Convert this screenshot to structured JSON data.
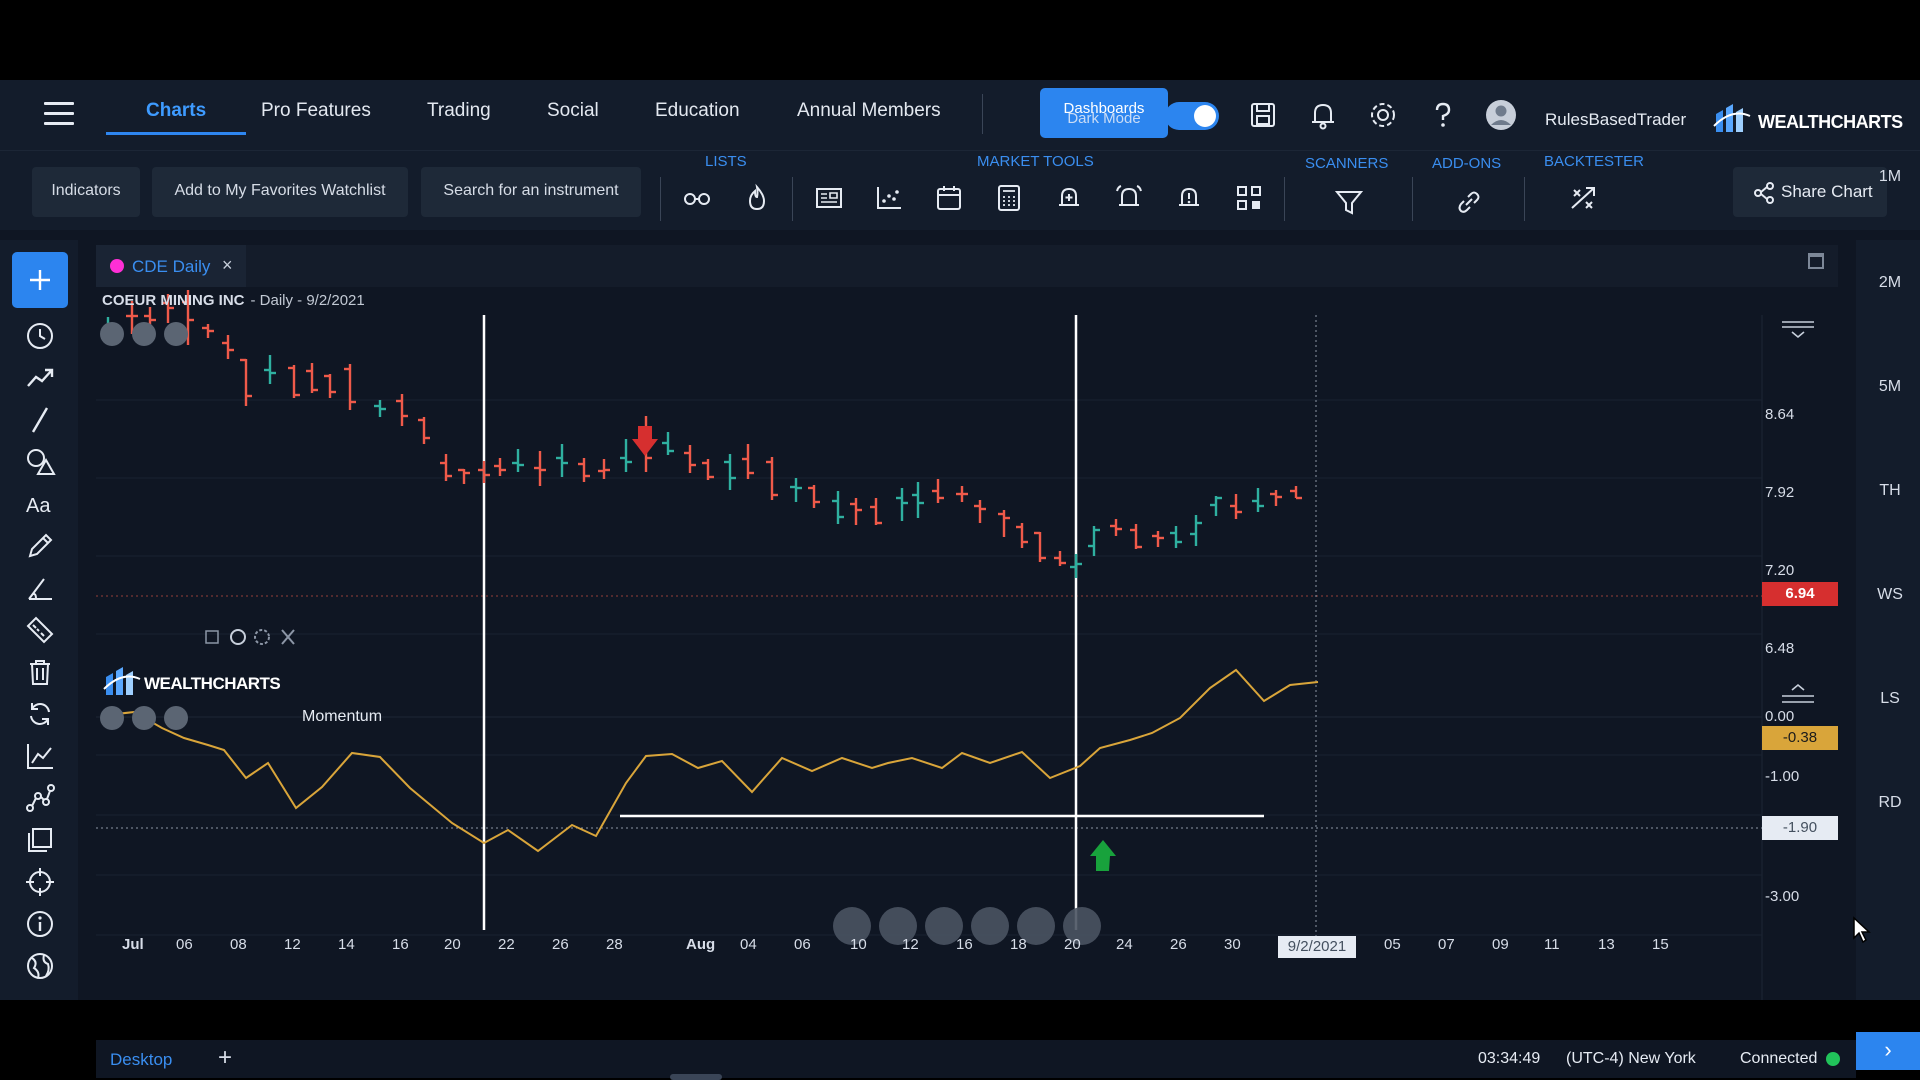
{
  "nav": {
    "tabs": [
      {
        "label": "Charts",
        "active": true
      },
      {
        "label": "Pro Features"
      },
      {
        "label": "Trading"
      },
      {
        "label": "Social"
      },
      {
        "label": "Education"
      },
      {
        "label": "Annual Members"
      }
    ],
    "dashboards_label": "Dashboards",
    "dark_mode_label": "Dark Mode",
    "username": "RulesBasedTrader",
    "brand": "WEALTHCHARTS"
  },
  "toolbar": {
    "indicators": "Indicators",
    "add_watchlist": "Add to My Favorites Watchlist",
    "search": "Search for an instrument",
    "lists_label": "LISTS",
    "market_tools_label": "MARKET TOOLS",
    "scanners_label": "SCANNERS",
    "addons_label": "ADD-ONS",
    "backtester_label": "BACKTESTER",
    "share": "Share Chart"
  },
  "chart": {
    "tab_name": "CDE Daily",
    "company": "COEUR MINING INC",
    "subtitle": "- Daily - 9/2/2021",
    "indicator_name": "Momentum",
    "watermark": "WEALTHCHARTS",
    "last_price": "6.94",
    "momentum_value": "-0.38",
    "crosshair_value": "-1.90",
    "price_ticks": [
      "8.64",
      "7.92",
      "7.20",
      "6.48"
    ],
    "momentum_ticks": [
      "0.00",
      "-1.00",
      "-3.00"
    ],
    "x_ticks": [
      "Jul",
      "06",
      "08",
      "12",
      "14",
      "16",
      "20",
      "22",
      "26",
      "28",
      "Aug",
      "04",
      "06",
      "10",
      "12",
      "16",
      "18",
      "20",
      "24",
      "26",
      "30",
      "05",
      "07",
      "09",
      "11",
      "13",
      "15"
    ],
    "crosshair_date": "9/2/2021",
    "colors": {
      "up": "#2fb0a0",
      "down": "#ef5a4a",
      "momentum": "#d9a53a",
      "accent": "#2c85ef"
    }
  },
  "timeframes": [
    "1M",
    "2M",
    "5M",
    "TH",
    "WS",
    "LS",
    "RD"
  ],
  "status": {
    "workspace": "Desktop",
    "time": "03:34:49",
    "timezone": "(UTC-4) New York",
    "connection": "Connected"
  }
}
